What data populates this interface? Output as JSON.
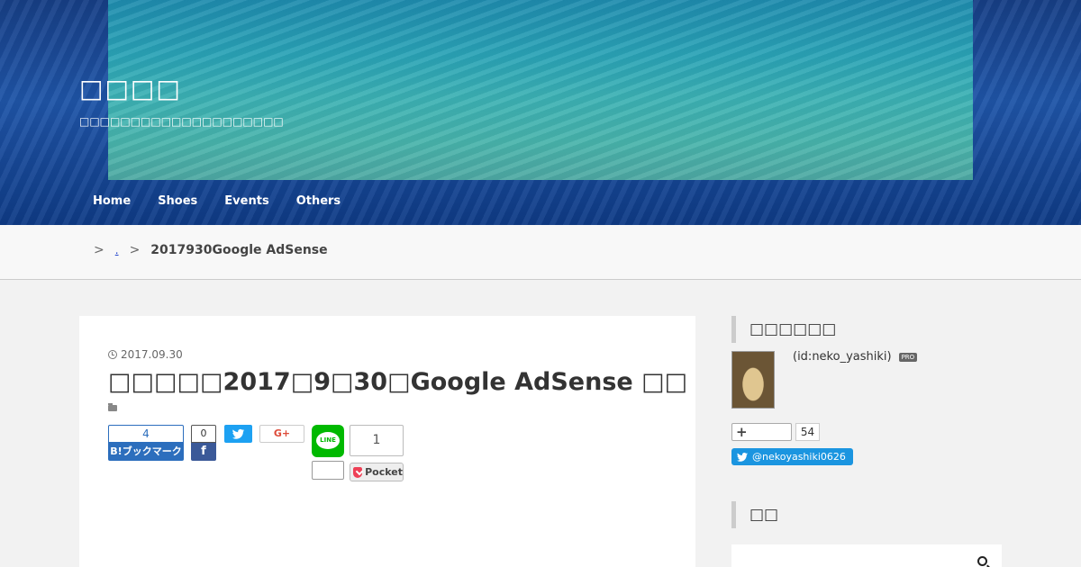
{
  "site": {
    "title": "□□□□",
    "description": "□□□□□□□□□□□□□□□□□□□□"
  },
  "nav": [
    "Home",
    "Shoes",
    "Events",
    "Others"
  ],
  "breadcrumb": {
    "separator": ">",
    "link": ".",
    "current": "2017930Google AdSense"
  },
  "article": {
    "date": "2017.09.30",
    "title": "□□□□□2017□9□30□Google AdSense □□",
    "share": {
      "hatena_count": "4",
      "hatena_label": "B!ブックマーク",
      "facebook_count": "0",
      "facebook_icon": "f",
      "googleplus_label": "G+",
      "line_label": "LINE",
      "pocket_count": "1",
      "pocket_label": "Pocket"
    }
  },
  "sidebar": {
    "profile_heading": "□□□□□□",
    "profile_id": "(id:neko_yashiki)",
    "pro_badge": "PRO",
    "subscribe_icon": "+",
    "subscribe_count": "54",
    "twitter_handle": "@nekoyashiki0626",
    "search_heading": "□□"
  },
  "colors": {
    "hatena": "#2c6ebd",
    "facebook": "#3b5998",
    "twitter": "#1da1f2",
    "line": "#00b900",
    "pocket": "#ee4056"
  }
}
